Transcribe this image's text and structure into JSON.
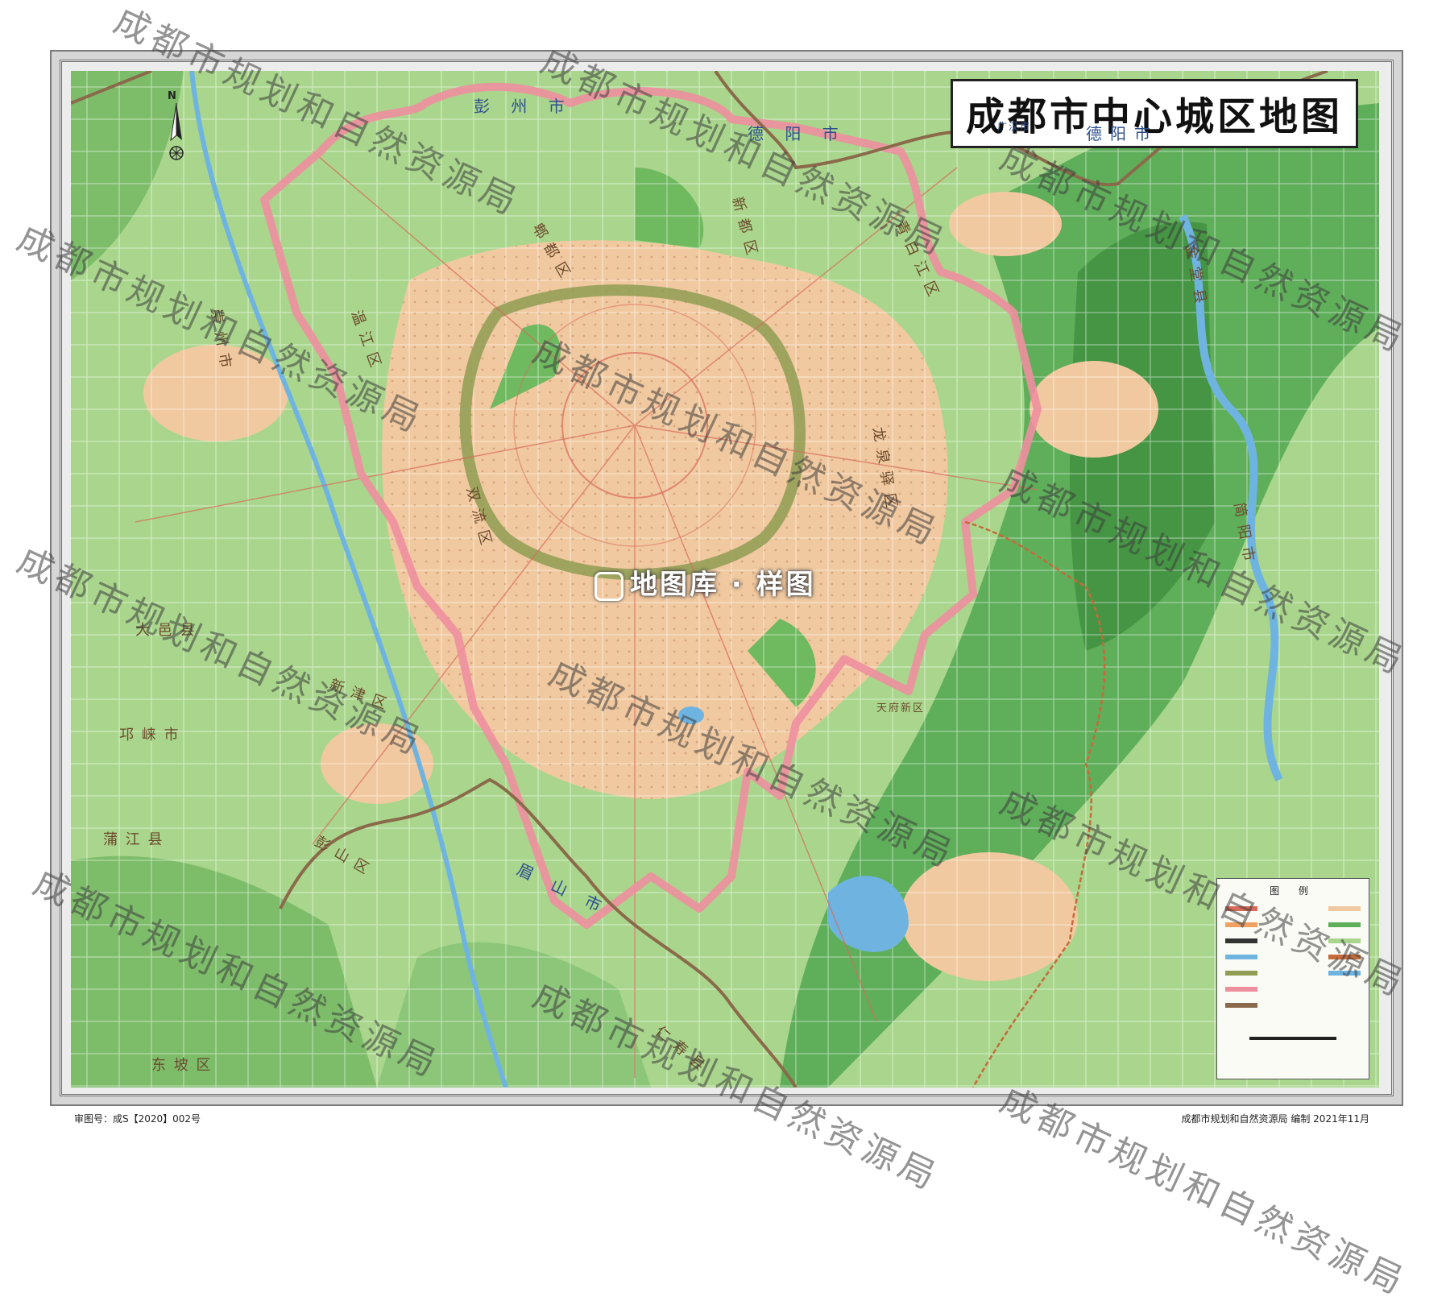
{
  "map": {
    "title": "成都市中心城区地图",
    "north_label": "N",
    "sample_badge": "地图库 · 样图",
    "approval_number": "审图号：成S【2020】002号",
    "credit": "成都市规划和自然资源局 编制  2021年11月",
    "legend_title": "图 例",
    "watermark_text": "成都市规划和自然资源局",
    "colors": {
      "urban": "#f1c9a0",
      "forest": "#5fae5a",
      "farmland": "#a9d68c",
      "boundary_pink": "#ee8f9e",
      "boundary_brown": "#8a6a4a",
      "water": "#6fb4e0",
      "ring_road": "#8f9c52"
    },
    "labels": [
      {
        "text": "彭 州 市",
        "kind": "city"
      },
      {
        "text": "德 阳 市",
        "kind": "city"
      },
      {
        "text": "德阳市",
        "kind": "city"
      },
      {
        "text": "广汉市",
        "kind": "city"
      },
      {
        "text": "郫 都 区",
        "kind": "district"
      },
      {
        "text": "新 都 区",
        "kind": "district"
      },
      {
        "text": "青 白 江 区",
        "kind": "district"
      },
      {
        "text": "温 江 区",
        "kind": "district"
      },
      {
        "text": "崇 州 市",
        "kind": "district"
      },
      {
        "text": "双 流 区",
        "kind": "district"
      },
      {
        "text": "龙 泉 驿 区",
        "kind": "district"
      },
      {
        "text": "新 津 区",
        "kind": "district"
      },
      {
        "text": "大 邑 县",
        "kind": "district"
      },
      {
        "text": "邛 崃 市",
        "kind": "district"
      },
      {
        "text": "蒲 江 县",
        "kind": "district"
      },
      {
        "text": "彭 山 区",
        "kind": "district"
      },
      {
        "text": "眉 山 市",
        "kind": "city"
      },
      {
        "text": "天府新区",
        "kind": "district"
      },
      {
        "text": "金 堂 县",
        "kind": "district"
      },
      {
        "text": "简 阳 市",
        "kind": "district"
      },
      {
        "text": "东 坡 区",
        "kind": "district"
      },
      {
        "text": "仁 寿 县",
        "kind": "district"
      }
    ]
  }
}
